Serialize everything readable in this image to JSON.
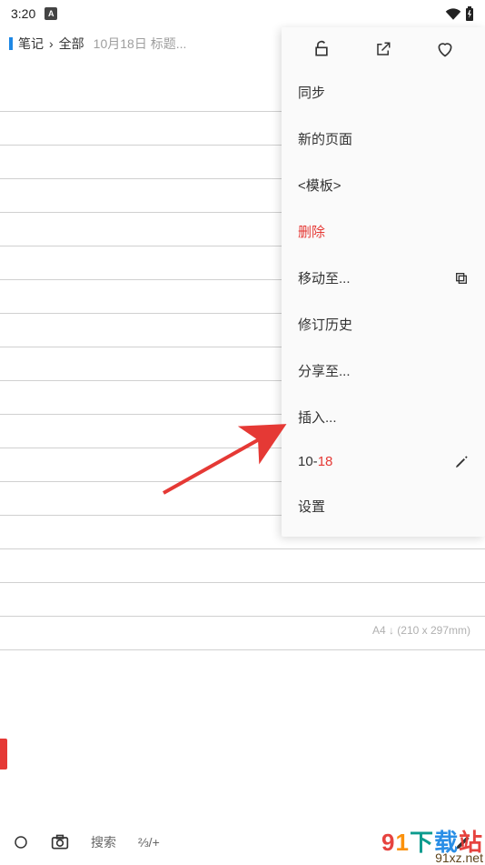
{
  "status": {
    "time": "3:20",
    "indicator": "A"
  },
  "breadcrumb": {
    "root": "笔记",
    "all": "全部",
    "subtitle": "10月18日 标题..."
  },
  "paper": {
    "size_label": "A4 ↓ (210 x 297mm)"
  },
  "menu": {
    "items": {
      "sync": "同步",
      "new_page": "新的页面",
      "template": "<模板>",
      "delete": "删除",
      "move_to": "移动至...",
      "revision": "修订历史",
      "share_to": "分享至...",
      "insert": "插入...",
      "date_prefix": "10-",
      "date_suffix": "18",
      "settings": "设置"
    }
  },
  "bottom": {
    "search": "搜索",
    "zoom": "⅔/+"
  },
  "watermark": {
    "line1_chars": [
      "9",
      "1",
      "下",
      "载",
      "站"
    ],
    "line2": "91xz.net"
  }
}
